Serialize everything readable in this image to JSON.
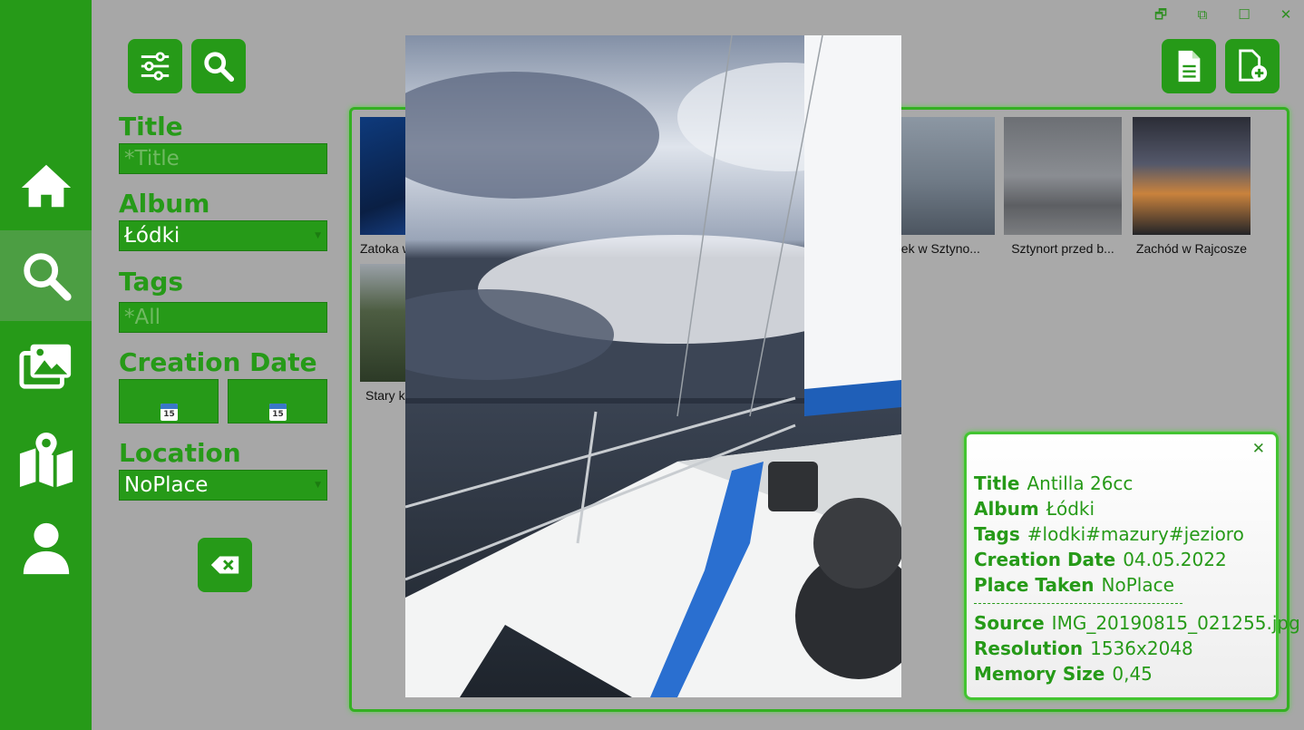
{
  "window": {
    "minimize": "🗗",
    "restore": "⧉",
    "maximize": "☐",
    "close": "✕"
  },
  "nav": {
    "items": [
      "home-icon",
      "search-icon",
      "gallery-icon",
      "map-icon",
      "user-icon"
    ],
    "active": "search"
  },
  "filters": {
    "title_label": "Title",
    "title_placeholder": "*Title",
    "album_label": "Album",
    "album_value": "Łódki",
    "tags_label": "Tags",
    "tags_placeholder": "*All",
    "creation_date_label": "Creation Date",
    "date_from_icon_text": "15",
    "date_to_icon_text": "15",
    "location_label": "Location",
    "location_value": "NoPlace"
  },
  "gallery": {
    "thumbnails": [
      {
        "caption": "Zatoka w"
      },
      {
        "caption": "nek w Sztyno..."
      },
      {
        "caption": "Sztynort przed b..."
      },
      {
        "caption": "Zachód w Rajcosze"
      },
      {
        "caption": "Stary ka"
      }
    ]
  },
  "info": {
    "close": "✕",
    "title_label": "Title",
    "title_value": "Antilla 26cc",
    "album_label": "Album",
    "album_value": "Łódki",
    "tags_label": "Tags",
    "tags_value": "#lodki#mazury#jezioro",
    "date_label": "Creation Date",
    "date_value": "04.05.2022",
    "place_label": "Place Taken",
    "place_value": "NoPlace",
    "source_label": "Source",
    "source_value": "IMG_20190815_021255.jpg",
    "resolution_label": "Resolution",
    "resolution_value": "1536x2048",
    "memory_label": "Memory Size",
    "memory_value": "0,45"
  },
  "colors": {
    "accent": "#269a18",
    "active_nav": "#4c9e43",
    "border_glow": "#43c431",
    "background": "#a7a7a7"
  }
}
